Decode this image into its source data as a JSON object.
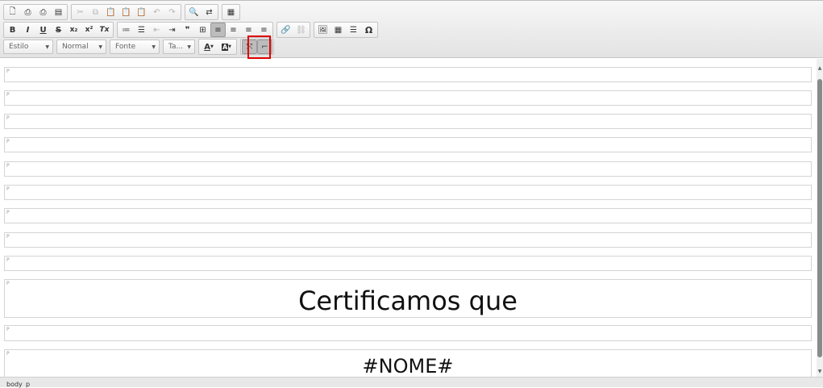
{
  "toolbar": {
    "row1": [
      {
        "icon": "new-page-icon",
        "glyph": "🗋"
      },
      {
        "icon": "preview-icon",
        "glyph": "⎙"
      },
      {
        "icon": "print-icon",
        "glyph": "⎙"
      },
      {
        "icon": "templates-icon",
        "glyph": "▤"
      },
      {
        "icon": "cut-icon",
        "glyph": "✂"
      },
      {
        "icon": "copy-icon",
        "glyph": "⧉"
      },
      {
        "icon": "paste-icon",
        "glyph": "📋"
      },
      {
        "icon": "paste-text-icon",
        "glyph": "📋"
      },
      {
        "icon": "paste-word-icon",
        "glyph": "📋"
      },
      {
        "icon": "undo-icon",
        "glyph": "↶"
      },
      {
        "icon": "redo-icon",
        "glyph": "↷"
      },
      {
        "icon": "find-icon",
        "glyph": "🔍"
      },
      {
        "icon": "replace-icon",
        "glyph": "⇄"
      },
      {
        "icon": "select-all-icon",
        "glyph": "▦"
      }
    ],
    "row2": [
      {
        "icon": "bold-icon",
        "glyph": "B"
      },
      {
        "icon": "italic-icon",
        "glyph": "I"
      },
      {
        "icon": "underline-icon",
        "glyph": "U"
      },
      {
        "icon": "strike-icon",
        "glyph": "S"
      },
      {
        "icon": "subscript-icon",
        "glyph": "x₂"
      },
      {
        "icon": "superscript-icon",
        "glyph": "x²"
      },
      {
        "icon": "remove-format-icon",
        "glyph": "Tx"
      },
      {
        "icon": "numbered-list-icon",
        "glyph": "≔"
      },
      {
        "icon": "bulleted-list-icon",
        "glyph": "☰"
      },
      {
        "icon": "outdent-icon",
        "glyph": "⇤"
      },
      {
        "icon": "indent-icon",
        "glyph": "⇥"
      },
      {
        "icon": "blockquote-icon",
        "glyph": "❞"
      },
      {
        "icon": "div-icon",
        "glyph": "⊞"
      },
      {
        "icon": "align-left-icon",
        "glyph": "≡"
      },
      {
        "icon": "align-center-icon",
        "glyph": "≡"
      },
      {
        "icon": "align-right-icon",
        "glyph": "≡"
      },
      {
        "icon": "justify-icon",
        "glyph": "≡"
      },
      {
        "icon": "link-icon",
        "glyph": "🔗"
      },
      {
        "icon": "unlink-icon",
        "glyph": "⛓"
      },
      {
        "icon": "image-icon",
        "glyph": "🖼"
      },
      {
        "icon": "table-icon",
        "glyph": "▦"
      },
      {
        "icon": "horizontal-line-icon",
        "glyph": "☰"
      },
      {
        "icon": "special-char-icon",
        "glyph": "Ω"
      }
    ],
    "combos": {
      "style": "Estilo",
      "format": "Normal",
      "font": "Fonte",
      "size": "Ta..."
    },
    "row3": [
      {
        "icon": "text-color-icon",
        "glyph": "A"
      },
      {
        "icon": "bg-color-icon",
        "glyph": "A"
      },
      {
        "icon": "maximize-icon",
        "glyph": "⤧"
      },
      {
        "icon": "show-blocks-icon",
        "glyph": "⌐"
      }
    ]
  },
  "document": {
    "paragraphs": [
      {
        "tag": "P",
        "text": ""
      },
      {
        "tag": "P",
        "text": ""
      },
      {
        "tag": "P",
        "text": ""
      },
      {
        "tag": "P",
        "text": ""
      },
      {
        "tag": "P",
        "text": ""
      },
      {
        "tag": "P",
        "text": ""
      },
      {
        "tag": "P",
        "text": ""
      },
      {
        "tag": "P",
        "text": ""
      },
      {
        "tag": "P",
        "text": ""
      },
      {
        "tag": "P",
        "text": "Certificamos que"
      },
      {
        "tag": "P",
        "text": ""
      },
      {
        "tag": "P",
        "text": "#NOME#"
      }
    ]
  },
  "statusbar": {
    "path_body": "body",
    "path_p": "p"
  },
  "colors": {
    "highlight": "#e00000",
    "toolbar_bg": "#ececec",
    "active_button": "#bcbcbc"
  }
}
